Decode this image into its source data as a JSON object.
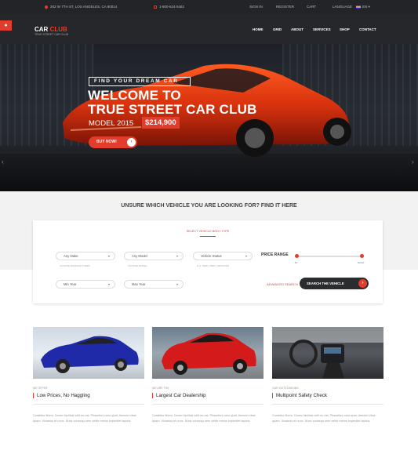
{
  "topbar": {
    "address": "202 W 7TH ST, LOS ANGELES, CA 90014",
    "phone": "1-800-624-5462",
    "sign_in": "SIGN IN",
    "register": "REGISTER",
    "cart": "CART",
    "language": "LANGUAGE",
    "lang_value": "EN"
  },
  "nav": {
    "logo_main": "CAR",
    "logo_accent": "CLUB",
    "logo_sub": "TRUE STREET CAR CLUB",
    "items": [
      "HOME",
      "GRID",
      "ABOUT",
      "SERVICES",
      "SHOP",
      "CONTACT"
    ]
  },
  "hero": {
    "eyebrow": "FIND YOUR DREAM CAR",
    "title_line1": "WELCOME TO",
    "title_line2": "TRUE STREET CAR CLUB",
    "model": "MODEL 2015",
    "price": "$214,900",
    "cta": "BUY NOW!"
  },
  "finder": {
    "heading": "UNSURE WHICH VEHICLE YOU ARE LOOKING FOR? FIND IT HERE",
    "body_type_label": "SELECT VEHICLE BODY TYPE",
    "any_make": "Any Make",
    "any_model": "Any Model",
    "vehicle_status": "Vehicle Status",
    "min_year": "Min Year",
    "max_year": "Max Year",
    "make_hint": "CHOOSE MANUFACTURER",
    "model_hint": "CHOOSE MODEL",
    "status_hint": "E.G. NEW, USED, CERTIFIED",
    "price_range_label": "PRICE RANGE",
    "price_min": "$0",
    "price_max": "$1000",
    "price_range_value": [
      0,
      1
    ],
    "advanced_search": "ADVANCED SEARCH",
    "search_button": "SEARCH THE VEHICLE"
  },
  "cards": [
    {
      "tag": "WE OFFER",
      "title": "Low Prices, No Haggling",
      "text": "Curabitur libero. Donec facilisis velit eu est. Phasellus cons quat. Aenean vitae quam. Vivamus et nunc. Nunc consequ sem velde metus imperdiet lacinia."
    },
    {
      "tag": "WE ARE THE",
      "title": "Largest Car Dealership",
      "text": "Curabitur libero. Donec facilisis velit eu est. Phasellus cons quat. Aenean vitae quam. Vivamus et nunc. Nunc consequ sem velde metus imperdiet lacinia."
    },
    {
      "tag": "OUR OUTSTANDING",
      "title": "Multipoint Safety Check",
      "text": "Curabitur libero. Donec facilisis velit eu est. Phasellus cons quat. Aenean vitae quam. Vivamus et nunc. Nunc consequ sem velde metus imperdiet lacinia."
    }
  ],
  "colors": {
    "accent": "#e23c2d",
    "dark": "#26272a"
  },
  "icons": [
    "location-pin-icon",
    "phone-icon",
    "flag-icon",
    "menu-icon",
    "arrow-right-icon",
    "chevron-left-icon",
    "chevron-right-icon"
  ]
}
